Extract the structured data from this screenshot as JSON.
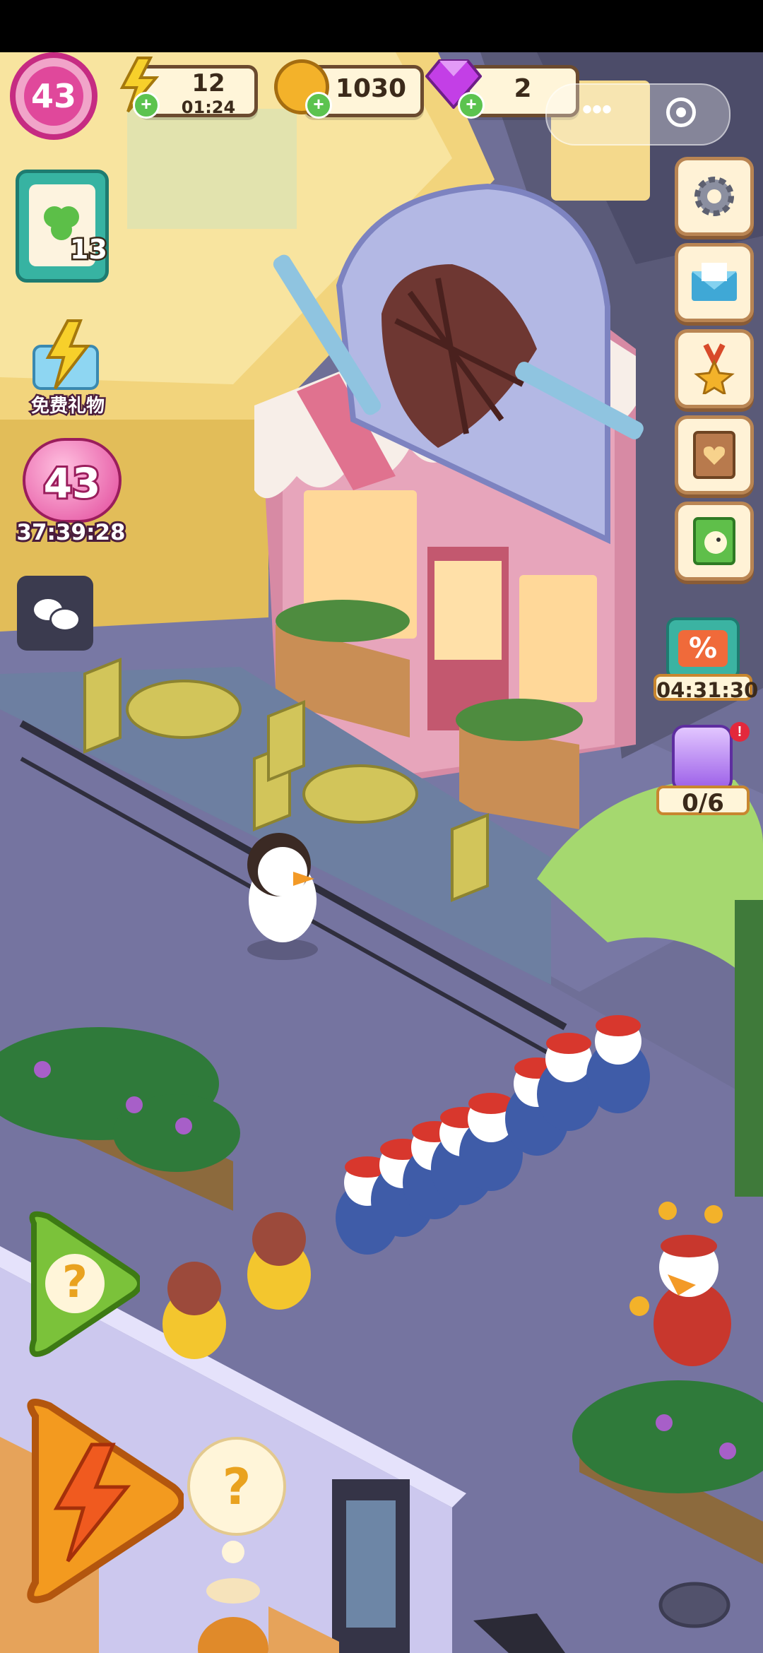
{
  "player": {
    "level": "43"
  },
  "resources": {
    "energy": {
      "value": "12",
      "timer": "01:24",
      "icon": "lightning-icon"
    },
    "coins": {
      "value": "1030",
      "icon": "coin-icon"
    },
    "gems": {
      "value": "2",
      "icon": "gem-icon"
    }
  },
  "miniprogram": {
    "menu_icon": "more-dots-icon",
    "close_icon": "target-circle-icon"
  },
  "tasks": {
    "count": "13",
    "icon": "clipboard-clover-icon"
  },
  "gift": {
    "label": "免费礼物",
    "icon": "gift-lightning-icon"
  },
  "level_event": {
    "level": "43",
    "timer": "37:39:28",
    "icon": "balloon-icon"
  },
  "chat": {
    "icon": "chat-bubbles-icon"
  },
  "side_menu": [
    {
      "name": "settings",
      "icon": "gear-icon"
    },
    {
      "name": "mail",
      "icon": "mail-icon"
    },
    {
      "name": "achievements",
      "icon": "medal-icon"
    },
    {
      "name": "recipe-book",
      "icon": "heart-book-icon"
    },
    {
      "name": "album",
      "icon": "chick-book-icon"
    }
  ],
  "sale": {
    "icon": "percent-tag-icon",
    "timer": "04:31:30"
  },
  "jar": {
    "icon": "potion-jar-icon",
    "progress": "0/6",
    "current": 0,
    "total": 6
  },
  "actions": {
    "help_icon": "question-icon",
    "boost_icon": "lightning-icon",
    "thought_icon": "question-bubble-icon"
  },
  "colors": {
    "hud_brown": "#6b4b2f",
    "level_pink": "#d9338b",
    "gem_purple": "#c33fe6",
    "coin_gold": "#f3b22a",
    "street": "#6f6f97"
  }
}
